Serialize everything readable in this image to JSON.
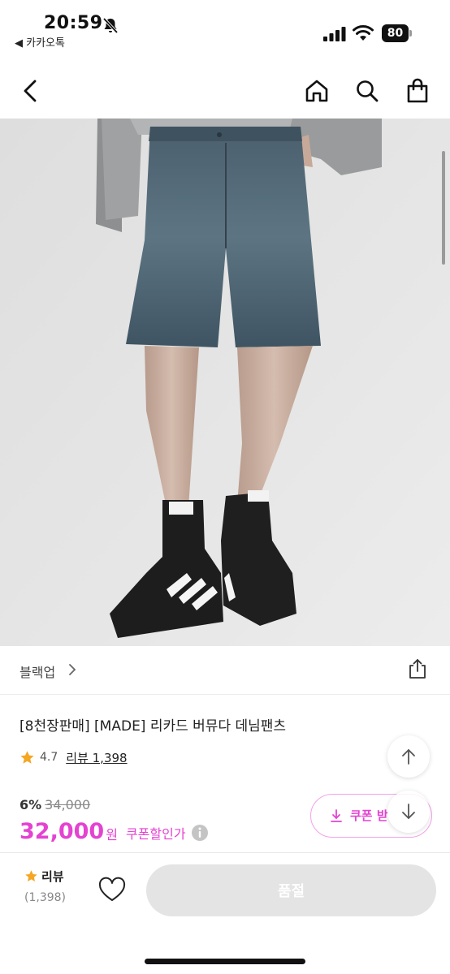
{
  "status_bar": {
    "time": "20:59",
    "back_app": "◀ 카카오톡",
    "battery": "80"
  },
  "nav": {
    "back": "back",
    "home": "home",
    "search": "search",
    "cart": "shopping-bag"
  },
  "product": {
    "brand": "블랙업",
    "title": "[8천장판매] [MADE] 리카드 버뮤다 데님팬츠",
    "rating": "4.7",
    "review_link": "리뷰 1,398",
    "discount_rate": "6%",
    "original_price": "34,000",
    "sale_price": "32,000",
    "currency": "원",
    "coupon_label": "쿠폰할인가",
    "coupon_button": "쿠폰 받"
  },
  "bottom_bar": {
    "review_label": "리뷰",
    "review_count": "(1,398)",
    "soldout_label": "품절"
  },
  "colors": {
    "accent": "#e443d1",
    "star": "#f5a623",
    "soldout_bg": "#e4e4e4"
  }
}
